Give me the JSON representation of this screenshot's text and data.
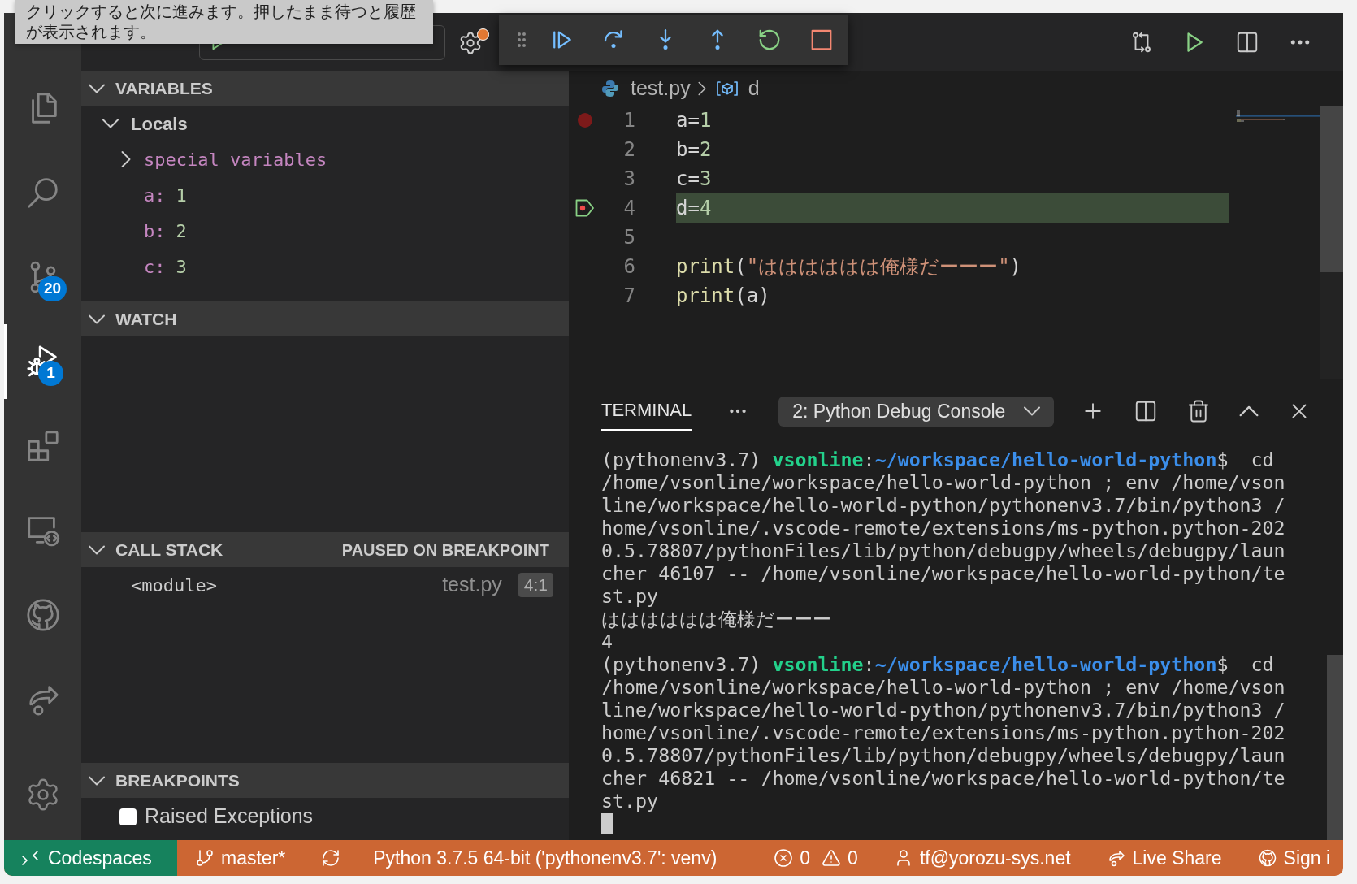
{
  "tooltip": {
    "text": "クリックすると次に進みます。押したまま待つと履歴が表示されます。"
  },
  "activity_bar": {
    "items": [
      {
        "selected": false
      },
      {
        "selected": false
      },
      {
        "selected": false,
        "badge": "20"
      },
      {
        "selected": true,
        "badge": "1"
      },
      {
        "selected": false
      },
      {
        "selected": false
      },
      {
        "selected": false
      },
      {
        "selected": false
      }
    ]
  },
  "sidebar": {
    "variables": {
      "title": "VARIABLES",
      "expanded": true,
      "scopes": [
        {
          "label": "Locals",
          "expanded": true,
          "children": [
            {
              "kind": "group",
              "label": "special variables",
              "expanded": false
            },
            {
              "kind": "variable",
              "label": "a:",
              "value": "1"
            },
            {
              "kind": "variable",
              "label": "b:",
              "value": "2"
            },
            {
              "kind": "variable",
              "label": "c:",
              "value": "3"
            }
          ]
        }
      ]
    },
    "watch": {
      "title": "WATCH",
      "expanded": true
    },
    "call_stack": {
      "title": "CALL STACK",
      "status": "PAUSED ON BREAKPOINT",
      "expanded": true,
      "frames": [
        {
          "name": "<module>",
          "file": "test.py",
          "position": "4:1"
        }
      ]
    },
    "breakpoints": {
      "title": "BREAKPOINTS",
      "expanded": true,
      "items": [
        {
          "label": "Raised Exceptions",
          "checked": false
        }
      ]
    }
  },
  "editor": {
    "breadcrumb": {
      "file": "test.py",
      "symbol": "d"
    },
    "lines": [
      {
        "number": "1",
        "breakpoint": true,
        "current": false,
        "tokens": [
          {
            "kind": "plain",
            "text": "a="
          },
          {
            "kind": "number",
            "text": "1"
          }
        ]
      },
      {
        "number": "2",
        "breakpoint": false,
        "current": false,
        "tokens": [
          {
            "kind": "plain",
            "text": "b="
          },
          {
            "kind": "number",
            "text": "2"
          }
        ]
      },
      {
        "number": "3",
        "breakpoint": false,
        "current": false,
        "tokens": [
          {
            "kind": "plain",
            "text": "c="
          },
          {
            "kind": "number",
            "text": "3"
          }
        ]
      },
      {
        "number": "4",
        "breakpoint": true,
        "current": true,
        "tokens": [
          {
            "kind": "plain",
            "text": "d="
          },
          {
            "kind": "number",
            "text": "4"
          }
        ]
      },
      {
        "number": "5",
        "breakpoint": false,
        "current": false
      },
      {
        "number": "6",
        "breakpoint": false,
        "current": false,
        "tokens": [
          {
            "kind": "function",
            "text": "print"
          },
          {
            "kind": "plain",
            "text": "("
          },
          {
            "kind": "string",
            "text": "\"はははははは俺様だーーー\""
          },
          {
            "kind": "plain",
            "text": ")"
          }
        ]
      },
      {
        "number": "7",
        "breakpoint": false,
        "current": false,
        "tokens": [
          {
            "kind": "function",
            "text": "print"
          },
          {
            "kind": "plain",
            "text": "(a)"
          }
        ]
      }
    ]
  },
  "panel": {
    "tabs": [
      {
        "label": "TERMINAL",
        "selected": true
      }
    ],
    "terminal": "2: Python Debug Console",
    "lines": [
      {
        "segments": [
          {
            "kind": "plain",
            "text": "(pythonenv3.7) "
          },
          {
            "kind": "user",
            "text": "vsonline"
          },
          {
            "kind": "plain",
            "text": ":"
          },
          {
            "kind": "path",
            "text": "~/workspace/hello-world-python"
          },
          {
            "kind": "plain",
            "text": "$  cd"
          }
        ]
      },
      {
        "segments": [
          {
            "kind": "plain",
            "text": "/home/vsonline/workspace/hello-world-python ; env /home/vson"
          }
        ]
      },
      {
        "segments": [
          {
            "kind": "plain",
            "text": "line/workspace/hello-world-python/pythonenv3.7/bin/python3 /"
          }
        ]
      },
      {
        "segments": [
          {
            "kind": "plain",
            "text": "home/vsonline/.vscode-remote/extensions/ms-python.python-202"
          }
        ]
      },
      {
        "segments": [
          {
            "kind": "plain",
            "text": "0.5.78807/pythonFiles/lib/python/debugpy/wheels/debugpy/laun"
          }
        ]
      },
      {
        "segments": [
          {
            "kind": "plain",
            "text": "cher 46107 -- /home/vsonline/workspace/hello-world-python/te"
          }
        ]
      },
      {
        "segments": [
          {
            "kind": "plain",
            "text": "st.py"
          }
        ]
      },
      {
        "segments": [
          {
            "kind": "plain",
            "text": "はははははは俺様だーーー"
          }
        ]
      },
      {
        "segments": [
          {
            "kind": "plain",
            "text": "4"
          }
        ]
      },
      {
        "segments": [
          {
            "kind": "plain",
            "text": "(pythonenv3.7) "
          },
          {
            "kind": "user",
            "text": "vsonline"
          },
          {
            "kind": "plain",
            "text": ":"
          },
          {
            "kind": "path",
            "text": "~/workspace/hello-world-python"
          },
          {
            "kind": "plain",
            "text": "$  cd"
          }
        ]
      },
      {
        "segments": [
          {
            "kind": "plain",
            "text": "/home/vsonline/workspace/hello-world-python ; env /home/vson"
          }
        ]
      },
      {
        "segments": [
          {
            "kind": "plain",
            "text": "line/workspace/hello-world-python/pythonenv3.7/bin/python3 /"
          }
        ]
      },
      {
        "segments": [
          {
            "kind": "plain",
            "text": "home/vsonline/.vscode-remote/extensions/ms-python.python-202"
          }
        ]
      },
      {
        "segments": [
          {
            "kind": "plain",
            "text": "0.5.78807/pythonFiles/lib/python/debugpy/wheels/debugpy/laun"
          }
        ]
      },
      {
        "segments": [
          {
            "kind": "plain",
            "text": "cher 46821 -- /home/vsonline/workspace/hello-world-python/te"
          }
        ]
      },
      {
        "segments": [
          {
            "kind": "plain",
            "text": "st.py"
          }
        ]
      }
    ]
  },
  "status_bar": {
    "remote": "Codespaces",
    "branch": "master*",
    "interpreter": "Python 3.7.5 64-bit ('pythonenv3.7': venv)",
    "errors": "0",
    "warnings": "0",
    "account": "tf@yorozu-sys.net",
    "live_share": "Live Share",
    "sign_in": "Sign i"
  }
}
